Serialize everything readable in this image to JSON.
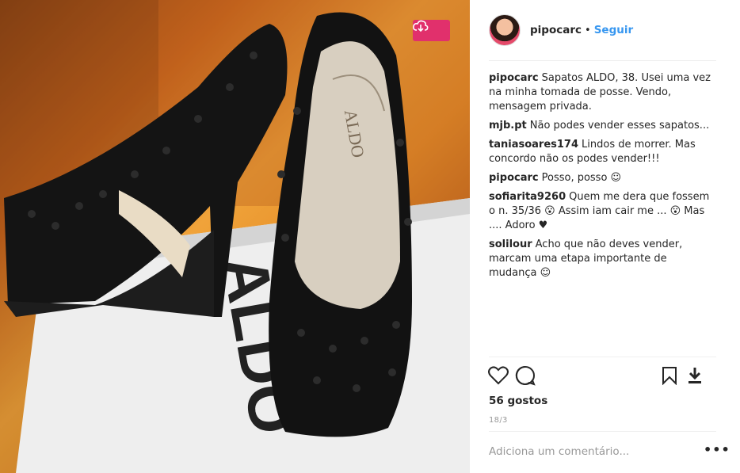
{
  "post": {
    "username": "pipocarc",
    "separator": "•",
    "follow_label": "Seguir",
    "likes": "56 gostos",
    "date": "18/3",
    "comment_placeholder": "Adiciona um comentário...",
    "more_label": "•••",
    "brand_text": "ALDO"
  },
  "comments": [
    {
      "user": "pipocarc",
      "text": "Sapatos ALDO, 38. Usei uma vez na minha tomada de posse. Vendo, mensagem privada."
    },
    {
      "user": "mjb.pt",
      "text": "Não podes vender esses sapatos..."
    },
    {
      "user": "taniasoares174",
      "text": "Lindos de morrer. Mas concordo não os podes vender!!!"
    },
    {
      "user": "pipocarc",
      "text": "Posso, posso ☺"
    },
    {
      "user": "sofiarita9260",
      "text": "Quem me dera que fossem o n. 35/36 😮 Assim iam cair me ... 😮 Mas .... Adoro ♥"
    },
    {
      "user": "solilour",
      "text": "Acho que não deves vender, marcam uma etapa importante de mudança ☺"
    }
  ],
  "icons": {
    "download_badge": "cloud-download-icon",
    "like": "heart-icon",
    "comment": "comment-bubble-icon",
    "save": "bookmark-icon",
    "download": "download-arrow-icon"
  },
  "colors": {
    "accent_link": "#3897f0",
    "download_badge": "#e1306c",
    "muted_text": "#999999"
  }
}
